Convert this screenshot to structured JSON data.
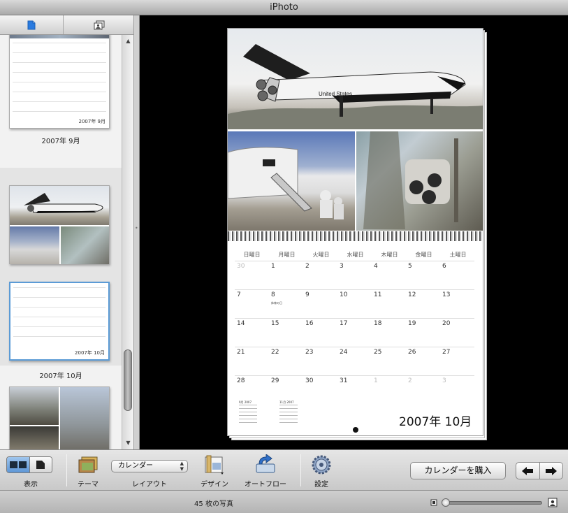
{
  "window": {
    "title": "iPhoto"
  },
  "sidebar": {
    "tabs": [
      {
        "name": "single-page-view",
        "icon": "single-page-icon"
      },
      {
        "name": "photo-browser-view",
        "icon": "photos-stack-icon"
      }
    ],
    "pages": [
      {
        "label": "2007年 9月",
        "thumb_month": "2007年 9月"
      },
      {
        "label": "2007年 10月",
        "thumb_month": "2007年 10月",
        "selected": true
      },
      {
        "label": ""
      }
    ]
  },
  "calendar": {
    "weekdays": [
      "日曜日",
      "月曜日",
      "火曜日",
      "水曜日",
      "木曜日",
      "金曜日",
      "土曜日"
    ],
    "weeks": [
      [
        "30",
        "1",
        "2",
        "3",
        "4",
        "5",
        "6"
      ],
      [
        "7",
        "8",
        "9",
        "10",
        "11",
        "12",
        "13"
      ],
      [
        "14",
        "15",
        "16",
        "17",
        "18",
        "19",
        "20"
      ],
      [
        "21",
        "22",
        "23",
        "24",
        "25",
        "26",
        "27"
      ],
      [
        "28",
        "29",
        "30",
        "31",
        "1",
        "2",
        "3"
      ]
    ],
    "event_note": "体育の日",
    "month_title": "2007年 10月",
    "prev_month_caption": "9月 2007",
    "next_month_caption": "11月 2007",
    "shuttle_text": "United States"
  },
  "toolbar": {
    "view_label": "表示",
    "theme_label": "テーマ",
    "layout_value": "カレンダー",
    "layout_label": "レイアウト",
    "design_label": "デザイン",
    "autoflow_label": "オートフロー",
    "settings_label": "設定",
    "buy_button": "カレンダーを購入"
  },
  "status": {
    "photo_count": "45 枚の写真"
  },
  "colors": {
    "selection": "#5b9bd6",
    "toolbar_active": "#6aa3dc",
    "canvas_bg": "#000000"
  }
}
